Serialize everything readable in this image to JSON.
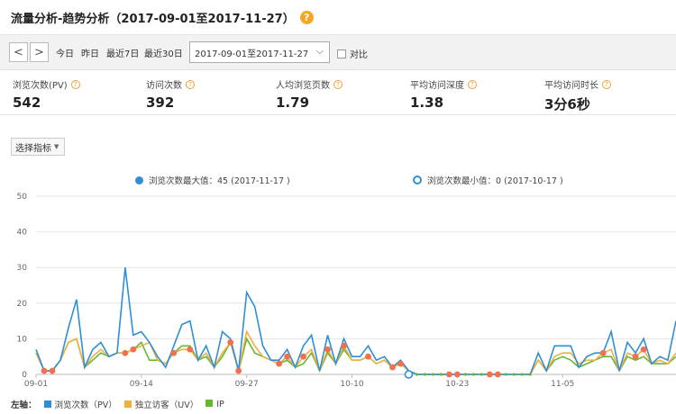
{
  "page": {
    "title": "流量分析-趋势分析（2017-09-01至2017-11-27）",
    "help": "?"
  },
  "toolbar": {
    "prev": "<",
    "next": ">",
    "ranges": [
      "今日",
      "昨日",
      "最近7日",
      "最近30日"
    ],
    "date_value": "2017-09-01至2017-11-27",
    "compare_label": "对比"
  },
  "metrics": [
    {
      "label": "浏览次数(PV)",
      "value": "542"
    },
    {
      "label": "访问次数",
      "value": "392"
    },
    {
      "label": "人均浏览页数",
      "value": "1.79"
    },
    {
      "label": "平均访问深度",
      "value": "1.38"
    },
    {
      "label": "平均访问时长",
      "value": "3分6秒"
    }
  ],
  "choose_metrics": "选择指标",
  "legend_top": {
    "max": "浏览次数最大值：45 (2017-11-17 )",
    "min": "浏览次数最小值：0 (2017-10-17 )"
  },
  "bottom_legend": {
    "axis": "左轴：",
    "items": [
      "浏览次数（PV）",
      "独立访客（UV）",
      "IP"
    ]
  },
  "colors": {
    "pv": "#2f8fd6",
    "uv": "#f0b040",
    "ip": "#66b832",
    "marker": "#f07050",
    "help": "#f5a623"
  },
  "chart_data": {
    "type": "line",
    "ylim": [
      0,
      50
    ],
    "yticks": [
      0,
      10,
      20,
      30,
      40,
      50
    ],
    "xtick_labels": [
      "09-01",
      "09-14",
      "09-27",
      "10-10",
      "10-23",
      "11-05"
    ],
    "xtick_days": [
      1,
      14,
      27,
      40,
      53,
      66
    ],
    "series": [
      {
        "name": "浏览次数（PV）",
        "values": [
          7,
          1,
          1,
          4,
          13,
          21,
          2,
          7,
          9,
          5,
          6,
          30,
          11,
          12,
          9,
          5,
          2,
          8,
          14,
          15,
          4,
          8,
          2,
          12,
          10,
          1,
          23,
          19,
          8,
          4,
          4,
          7,
          2,
          8,
          11,
          1,
          11,
          3,
          10,
          5,
          5,
          8,
          4,
          5,
          2,
          4,
          1,
          0,
          0,
          0,
          0,
          0,
          0,
          0,
          0,
          0,
          0,
          0,
          0,
          0,
          0,
          0,
          6,
          1,
          8,
          8,
          8,
          2,
          5,
          6,
          6,
          12,
          1,
          9,
          6,
          10,
          3,
          5,
          4,
          15
        ]
      },
      {
        "name": "独立访客（UV）",
        "values": [
          6,
          1,
          1,
          4,
          9,
          10,
          2,
          5,
          7,
          5,
          6,
          6,
          7,
          8,
          9,
          4,
          3,
          6,
          7,
          7,
          4,
          6,
          2,
          6,
          9,
          1,
          12,
          8,
          5,
          4,
          3,
          5,
          2,
          5,
          7,
          1,
          7,
          3,
          8,
          4,
          4,
          5,
          3,
          4,
          2,
          3,
          1,
          0,
          0,
          0,
          0,
          0,
          0,
          0,
          0,
          0,
          0,
          0,
          0,
          0,
          0,
          0,
          4,
          1,
          5,
          6,
          6,
          3,
          4,
          4,
          6,
          7,
          1,
          6,
          5,
          7,
          3,
          4,
          3,
          6
        ]
      },
      {
        "name": "IP",
        "values": [
          6,
          1,
          1,
          4,
          9,
          10,
          2,
          4,
          6,
          5,
          6,
          6,
          7,
          9,
          4,
          4,
          3,
          6,
          8,
          8,
          4,
          5,
          2,
          5,
          9,
          1,
          10,
          6,
          5,
          4,
          3,
          4,
          2,
          3,
          6,
          1,
          6,
          3,
          7,
          4,
          4,
          5,
          3,
          4,
          2,
          3,
          1,
          0,
          0,
          0,
          0,
          0,
          0,
          0,
          0,
          0,
          0,
          0,
          0,
          0,
          0,
          0,
          4,
          1,
          4,
          5,
          4,
          2,
          3,
          4,
          5,
          5,
          1,
          5,
          4,
          5,
          3,
          3,
          3,
          5
        ]
      }
    ]
  }
}
